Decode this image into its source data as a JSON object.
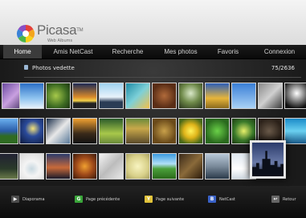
{
  "brand": {
    "name": "Picasa",
    "tm": "TM",
    "subtitle": "Web Albums"
  },
  "nav": {
    "items": [
      {
        "label": "Home",
        "active": true
      },
      {
        "label": "Amis NetCast",
        "active": false
      },
      {
        "label": "Recherche",
        "active": false
      },
      {
        "label": "Mes photos",
        "active": false
      },
      {
        "label": "Favoris",
        "active": false
      },
      {
        "label": "Connexion",
        "active": false
      }
    ]
  },
  "section": {
    "title": "Photos vedette",
    "count": "75/2636"
  },
  "photos": {
    "rows": [
      [
        "purple-flowers",
        "sky-and-clouds",
        "green-foliage",
        "yellow-sunset",
        "swan-silhouette",
        "teal-seascape",
        "brown-texture",
        "forest-moss",
        "golden-trees",
        "blue-sky",
        "grey-branches",
        "black-white-tree"
      ],
      [
        "hill-horizon",
        "blue-moon",
        "white-bird",
        "lamp-post",
        "green-path",
        "rusty-leaves",
        "yellow-flower",
        "fern-leaves",
        "green-flowers",
        "dark-animal",
        "grey-rocks",
        "blue-water"
      ],
      [
        "dark-fields",
        "white-cup",
        "dusk-sky",
        "orange-leaf",
        "white-abstract",
        "pale-yellow",
        "green-field",
        "brown-texture-2",
        "city-street",
        "white-sky",
        "night-skyline"
      ]
    ],
    "selected": {
      "row": 2,
      "col": 10,
      "name": "night-skyline"
    }
  },
  "legend": [
    {
      "key": "▶",
      "color": "#4c4c4c",
      "icon": "play-icon",
      "label": "Diaporama"
    },
    {
      "key": "G",
      "color": "#3aa53a",
      "icon": "green-key-icon",
      "label": "Page précédente"
    },
    {
      "key": "Y",
      "color": "#e0c23a",
      "icon": "yellow-key-icon",
      "label": "Page suivante"
    },
    {
      "key": "B",
      "color": "#3a62c8",
      "icon": "blue-key-icon",
      "label": "NetCast"
    },
    {
      "key": "↩",
      "color": "#666666",
      "icon": "return-icon",
      "label": "Retour"
    }
  ]
}
